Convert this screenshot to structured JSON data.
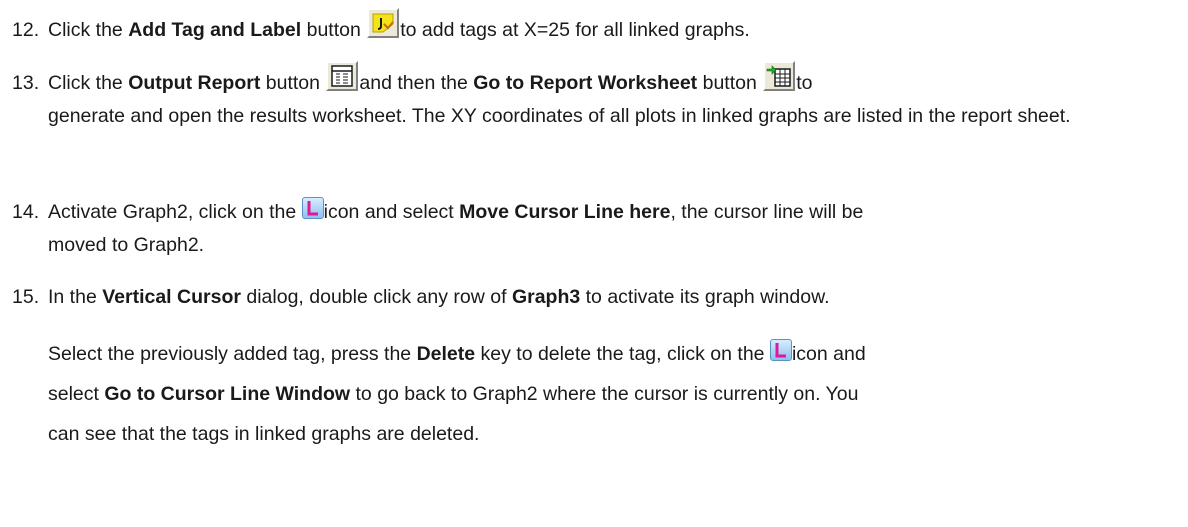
{
  "icons": {
    "add_tag_label": "add-tag-label-icon",
    "output_report": "output-report-icon",
    "go_to_report": "go-to-report-worksheet-icon",
    "cursor_menu": "cursor-line-L-icon"
  },
  "steps": [
    {
      "num": "12.",
      "t1": "Click the ",
      "b1": "Add Tag and Label",
      "t2": " button ",
      "t3": "to add tags at X=25 for all linked graphs."
    },
    {
      "num": "13.",
      "t1": "Click the ",
      "b1": "Output Report",
      "t2": " button ",
      "t3": "and then the ",
      "b2": "Go to Report Worksheet",
      "t4": " button ",
      "t5": "to",
      "cont": "generate and open the results worksheet. The XY coordinates of all plots in linked graphs are listed in the report sheet."
    },
    {
      "num": "14.",
      "t1": "Activate Graph2, click on the ",
      "t2": "icon and select ",
      "b1": "Move Cursor Line here",
      "t3": ", the cursor line will be",
      "cont": "moved to Graph2."
    },
    {
      "num": "15.",
      "t1": "In the ",
      "b1": "Vertical Cursor",
      "t2": " dialog, double click any row of ",
      "b2": "Graph3",
      "t3": " to activate its graph window."
    }
  ],
  "para": {
    "t1": "Select the previously added tag, press the ",
    "b1": "Delete",
    "t2": " key to delete the tag, click on the ",
    "t3": "icon and",
    "t4": "select ",
    "b2": "Go to Cursor Line Window",
    "t5": " to go back to Graph2 where the cursor is currently on. You",
    "t6": "can see that the tags in linked graphs are deleted."
  }
}
